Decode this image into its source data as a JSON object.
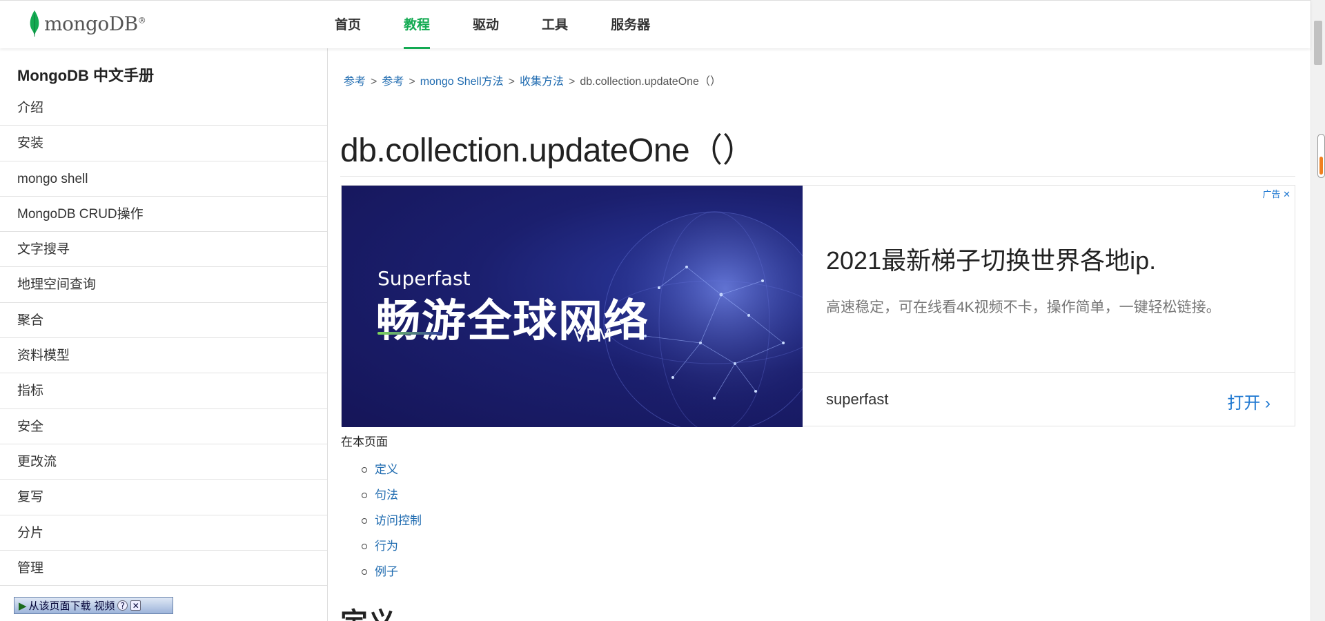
{
  "header": {
    "logo_text": "mongoDB",
    "logo_mark": "®",
    "nav": [
      {
        "label": "首页"
      },
      {
        "label": "教程"
      },
      {
        "label": "驱动"
      },
      {
        "label": "工具"
      },
      {
        "label": "服务器"
      }
    ],
    "active_nav": "教程",
    "accent_color": "#13aa52"
  },
  "sidebar": {
    "title": "MongoDB 中文手册",
    "items": [
      {
        "label": "介绍"
      },
      {
        "label": "安装"
      },
      {
        "label": "mongo shell"
      },
      {
        "label": "MongoDB CRUD操作"
      },
      {
        "label": "文字搜寻"
      },
      {
        "label": "地理空间查询"
      },
      {
        "label": "聚合"
      },
      {
        "label": "资料模型"
      },
      {
        "label": "指标"
      },
      {
        "label": "安全"
      },
      {
        "label": "更改流"
      },
      {
        "label": "复写"
      },
      {
        "label": "分片"
      },
      {
        "label": "管理"
      }
    ],
    "download_bar": {
      "label": "从该页面下载 视频",
      "help": "?",
      "close": "✕"
    }
  },
  "breadcrumb": {
    "items": [
      {
        "label": "参考"
      },
      {
        "label": "参考"
      },
      {
        "label": "mongo Shell方法"
      },
      {
        "label": "收集方法"
      }
    ],
    "current": "db.collection.updateOne（）",
    "separator": ">"
  },
  "page": {
    "title": "db.collection.updateOne（）"
  },
  "ad": {
    "tag": "广告",
    "close_icon": "close-icon",
    "image_text_en": "Superfast",
    "image_text_cn": "畅游全球网络",
    "image_text_sub": "VPM",
    "headline": "2021最新梯子切换世界各地ip.",
    "description": "高速稳定，可在线看4K视频不卡，操作简单，一键轻松链接。",
    "brand": "superfast",
    "cta": "打开",
    "cta_icon": "chevron-right-icon",
    "cta_color": "#1f78d1"
  },
  "toc": {
    "label": "在本页面",
    "items": [
      {
        "label": "定义"
      },
      {
        "label": "句法"
      },
      {
        "label": "访问控制"
      },
      {
        "label": "行为"
      },
      {
        "label": "例子"
      }
    ]
  },
  "section": {
    "heading": "定义"
  }
}
